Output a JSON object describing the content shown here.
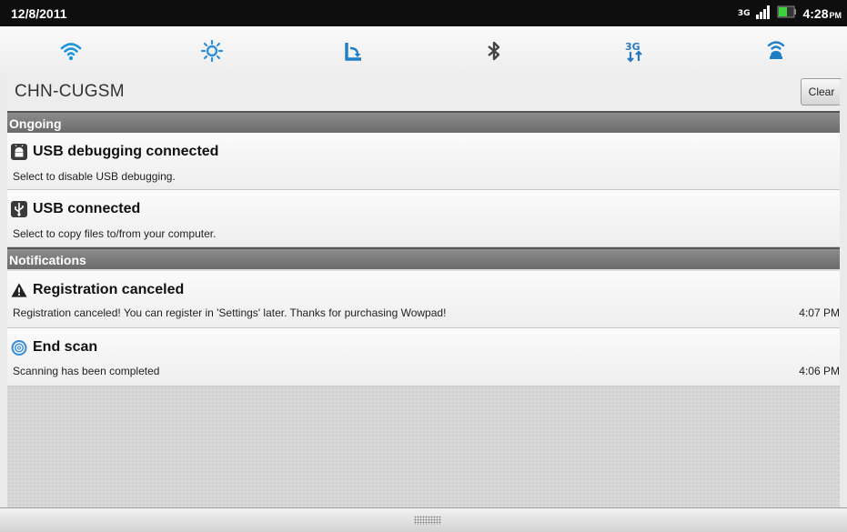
{
  "status_bar": {
    "date": "12/8/2011",
    "network_type": "3G",
    "time": "4:28",
    "time_suffix": "PM"
  },
  "quick_toggles": [
    {
      "icon": "wifi-icon",
      "color": "#2196d8"
    },
    {
      "icon": "brightness-icon",
      "color": "#2f8fd8"
    },
    {
      "icon": "auto-rotate-icon",
      "color": "#1f7fc6"
    },
    {
      "icon": "bluetooth-icon",
      "color": "#444444"
    },
    {
      "icon": "mobile-data-3g-icon",
      "color": "#2a78c0"
    },
    {
      "icon": "gps-icon",
      "color": "#1f7fc6"
    }
  ],
  "carrier": {
    "name": "CHN-CUGSM",
    "clear_label": "Clear"
  },
  "sections": {
    "ongoing_label": "Ongoing",
    "notifications_label": "Notifications"
  },
  "ongoing": [
    {
      "icon": "android-debug-icon",
      "title": "USB debugging connected",
      "subtitle": "Select to disable USB debugging."
    },
    {
      "icon": "usb-icon",
      "title": "USB connected",
      "subtitle": "Select to copy files to/from your computer."
    }
  ],
  "notifications": [
    {
      "icon": "warning-icon",
      "title": "Registration canceled",
      "subtitle": "Registration canceled! You can register in 'Settings' later. Thanks for purchasing Wowpad!",
      "time": "4:07 PM"
    },
    {
      "icon": "scan-icon",
      "title": "End scan",
      "subtitle": "Scanning has been completed",
      "time": "4:06 PM"
    }
  ]
}
